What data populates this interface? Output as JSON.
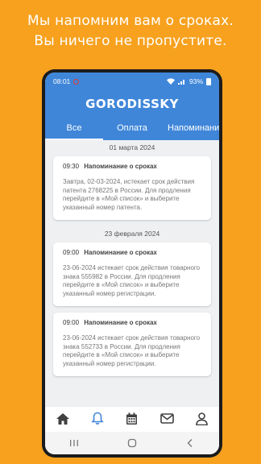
{
  "promo": {
    "line1": "Мы напомним вам о сроках.",
    "line2": "Вы ничего не пропустите."
  },
  "statusbar": {
    "time": "08:01",
    "battery": "93%"
  },
  "app": {
    "logo": "GORODISSKY"
  },
  "tabs": [
    {
      "label": "Все",
      "active": true
    },
    {
      "label": "Оплата",
      "active": false
    },
    {
      "label": "Напоминания",
      "active": false
    }
  ],
  "groups": [
    {
      "date": "01 марта 2024",
      "cards": [
        {
          "time": "09:30",
          "title": "Напоминание о сроках",
          "body": "Завтра, 02-03-2024, истекает срок действия патента 2768225 в России. Для продления перейдите в «Мой список» и выберите указанный номер патента."
        }
      ]
    },
    {
      "date": "23 февраля 2024",
      "cards": [
        {
          "time": "09:00",
          "title": "Напоминание о сроках",
          "body": "23-06-2024 истекает срок действия товарного знака 555982 в России. Для продления перейдите в «Мой список» и выберите указанный номер регистрации."
        },
        {
          "time": "09:00",
          "title": "Напоминание о сроках",
          "body": "23-06-2024 истекает срок действия товарного знака 552733 в России. Для продления перейдите в «Мой список» и выберите указанный номер регистрации."
        }
      ]
    }
  ],
  "bottom_nav": [
    {
      "icon": "home-icon",
      "active": false
    },
    {
      "icon": "bell-icon",
      "active": true
    },
    {
      "icon": "calendar-icon",
      "active": false
    },
    {
      "icon": "envelope-icon",
      "active": false
    },
    {
      "icon": "user-icon",
      "active": false
    }
  ],
  "colors": {
    "background": "#F7A11E",
    "primary": "#3F86D9",
    "nav_active": "#3F86D9",
    "nav_inactive": "#404040"
  }
}
